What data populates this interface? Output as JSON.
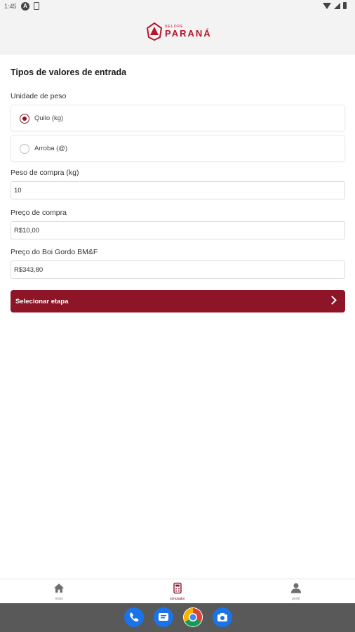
{
  "status_bar": {
    "time": "1:45",
    "a_badge": "A"
  },
  "header": {
    "logo_small": "NELORE",
    "logo_big": "PARANÁ"
  },
  "form": {
    "title": "Tipos de valores de entrada",
    "weight_unit_label": "Unidade de peso",
    "options": [
      {
        "label": "Quilo (kg)",
        "selected": true
      },
      {
        "label": "Arroba (@)",
        "selected": false
      }
    ],
    "purchase_weight": {
      "label": "Peso de compra (kg)",
      "value": "10"
    },
    "purchase_price": {
      "label": "Preço de compra",
      "value": "R$10,00"
    },
    "boi_gordo_price": {
      "label": "Preço do Boi Gordo BM&F",
      "value": "R$343,80"
    },
    "submit_label": "Selecionar etapa"
  },
  "bottom_nav": {
    "items": [
      {
        "label": "início",
        "icon": "home-icon",
        "active": false
      },
      {
        "label": "simulador",
        "icon": "calculator-icon",
        "active": true
      },
      {
        "label": "perfil",
        "icon": "person-icon",
        "active": false
      }
    ]
  },
  "dock": {
    "apps": [
      "phone-icon",
      "messages-icon",
      "chrome-icon",
      "camera-icon"
    ]
  },
  "colors": {
    "brand": "#8e1427",
    "logo": "#b8142a",
    "header_bg": "#f3f3f3"
  }
}
